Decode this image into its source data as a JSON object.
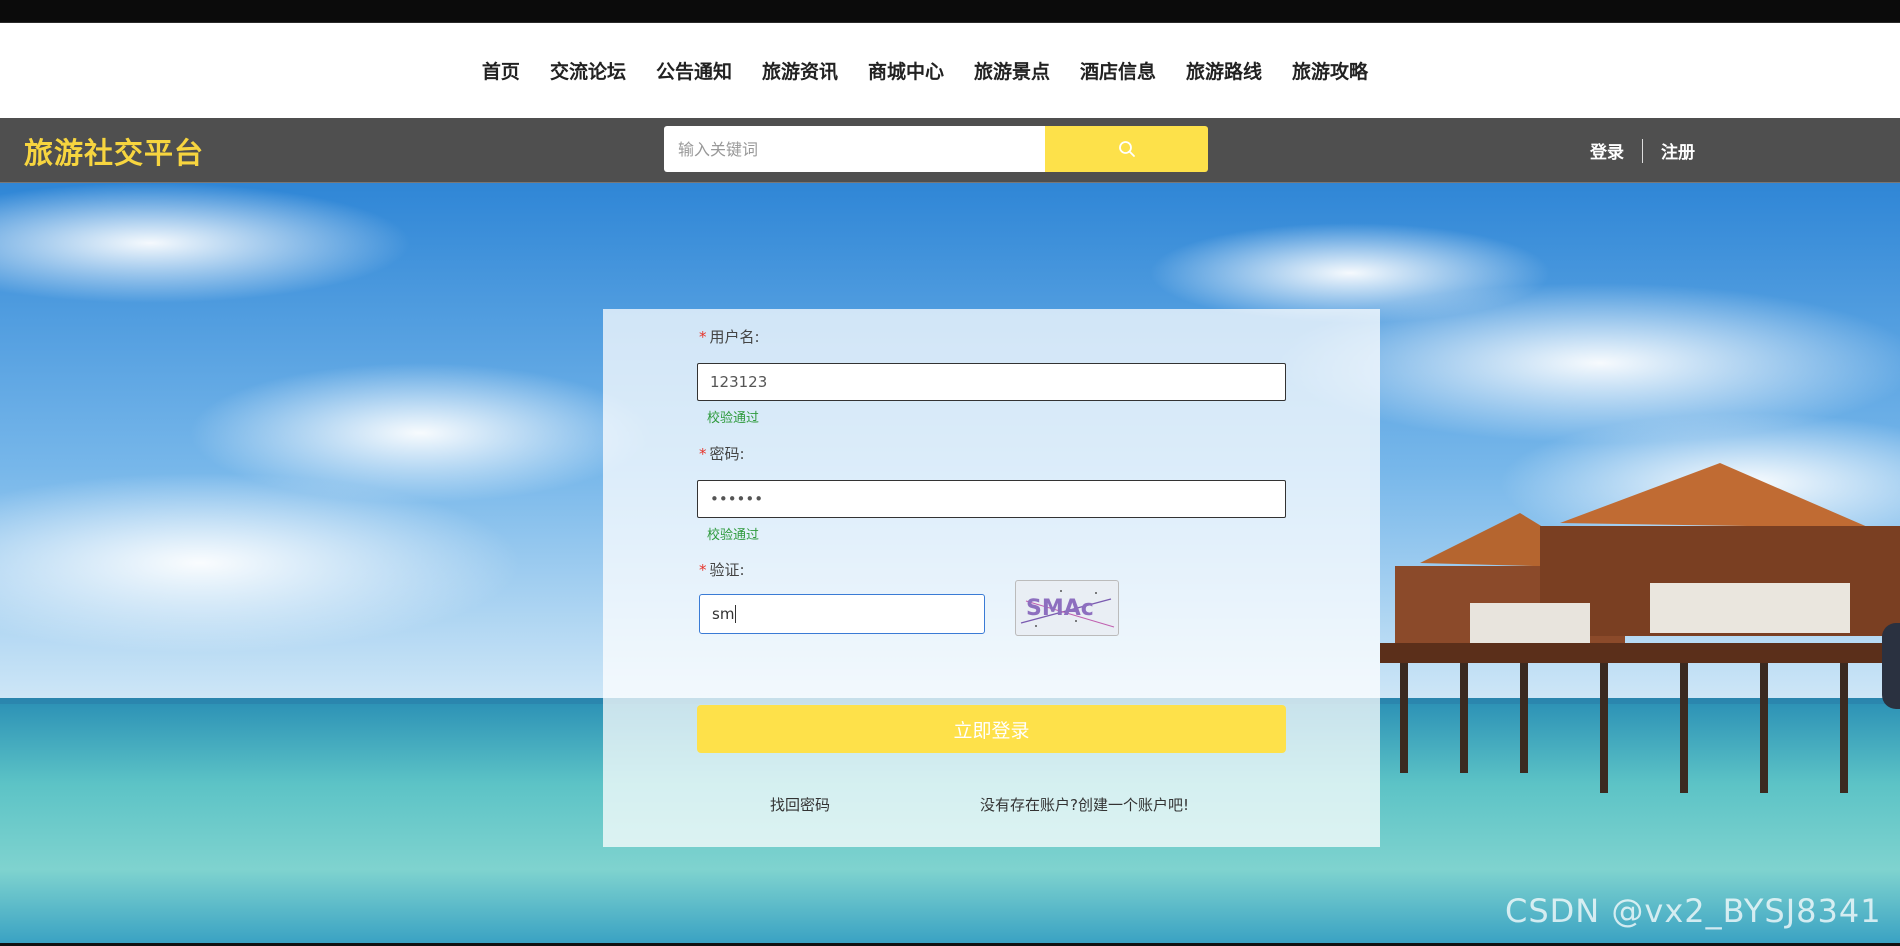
{
  "nav": {
    "items": [
      "首页",
      "交流论坛",
      "公告通知",
      "旅游资讯",
      "商城中心",
      "旅游景点",
      "酒店信息",
      "旅游路线",
      "旅游攻略"
    ]
  },
  "header": {
    "brand": "旅游社交平台",
    "search_placeholder": "输入关键词",
    "search_icon": "search-icon",
    "login_label": "登录",
    "register_label": "注册"
  },
  "login_form": {
    "username_label": "用户名:",
    "username_value": "123123",
    "username_status": "校验通过",
    "password_label": "密码:",
    "password_value": "••••••",
    "password_status": "校验通过",
    "captcha_label": "验证:",
    "captcha_value": "sm",
    "captcha_code": "SMAc",
    "submit_label": "立即登录",
    "forgot_label": "找回密码",
    "register_link_label": "没有存在账户?创建一个账户吧!"
  },
  "watermark": "CSDN @vx2_BYSJ8341",
  "colors": {
    "brand": "#f7d53f",
    "accent": "#fde14a",
    "success": "#2e9a3c",
    "required": "#e6352b"
  }
}
